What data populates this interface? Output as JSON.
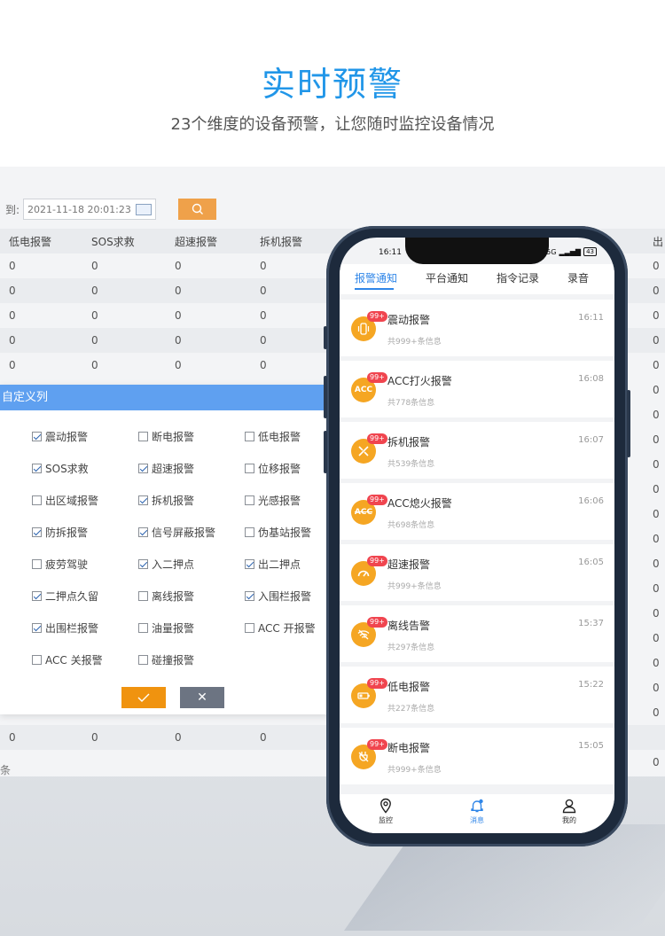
{
  "hero": {
    "title": "实时预警",
    "subtitle": "23个维度的设备预警，让您随时监控设备情况"
  },
  "desktop": {
    "filter_label": "到:",
    "date_value": "2021-11-18 20:01:23",
    "columns": [
      "低电报警",
      "SOS求救",
      "超速报警",
      "拆机报警",
      "出"
    ],
    "rows": [
      [
        "0",
        "0",
        "0",
        "0",
        "0"
      ],
      [
        "0",
        "0",
        "0",
        "0",
        "0"
      ],
      [
        "0",
        "0",
        "0",
        "0",
        "0"
      ],
      [
        "0",
        "0",
        "0",
        "0",
        "0"
      ],
      [
        "0",
        "0",
        "0",
        "0",
        "0"
      ]
    ],
    "side_zeros": [
      "0",
      "0",
      "0",
      "0",
      "0",
      "0",
      "0",
      "0",
      "0",
      "0",
      "0",
      "0",
      "0",
      "0",
      "0",
      "0",
      "0",
      "0",
      "0"
    ],
    "bottom_row": [
      "0",
      "0",
      "0",
      "0"
    ],
    "footer": "条"
  },
  "dialog": {
    "title": "自定义列",
    "options": [
      {
        "label": "震动报警",
        "checked": true
      },
      {
        "label": "断电报警",
        "checked": false
      },
      {
        "label": "低电报警",
        "checked": false
      },
      {
        "label": "SOS求救",
        "checked": true
      },
      {
        "label": "超速报警",
        "checked": true
      },
      {
        "label": "位移报警",
        "checked": false
      },
      {
        "label": "出区域报警",
        "checked": false
      },
      {
        "label": "拆机报警",
        "checked": true
      },
      {
        "label": "光感报警",
        "checked": false
      },
      {
        "label": "防拆报警",
        "checked": true
      },
      {
        "label": "信号屏蔽报警",
        "checked": true
      },
      {
        "label": "伪基站报警",
        "checked": false
      },
      {
        "label": "疲劳驾驶",
        "checked": false
      },
      {
        "label": "入二押点",
        "checked": true
      },
      {
        "label": "出二押点",
        "checked": true
      },
      {
        "label": "二押点久留",
        "checked": true
      },
      {
        "label": "离线报警",
        "checked": false
      },
      {
        "label": "入围栏报警",
        "checked": true
      },
      {
        "label": "出围栏报警",
        "checked": true
      },
      {
        "label": "油量报警",
        "checked": false
      },
      {
        "label": "ACC 开报警",
        "checked": false
      },
      {
        "label": "ACC 关报警",
        "checked": false
      },
      {
        "label": "碰撞报警",
        "checked": false
      }
    ],
    "ok_icon": "check-icon",
    "cancel_label": "✕"
  },
  "phone": {
    "status_time": "16:11",
    "signal": "5G",
    "battery": "43",
    "tabs": [
      "报警通知",
      "平台通知",
      "指令记录",
      "录音"
    ],
    "active_tab": 0,
    "items": [
      {
        "icon": "vibration-icon",
        "badge": "99+",
        "title": "震动报警",
        "time": "16:11",
        "sub": "共999+条信息"
      },
      {
        "icon": "acc-on-icon",
        "badge": "99+",
        "title": "ACC打火报警",
        "time": "16:08",
        "sub": "共778条信息"
      },
      {
        "icon": "tools-icon",
        "badge": "99+",
        "title": "拆机报警",
        "time": "16:07",
        "sub": "共539条信息"
      },
      {
        "icon": "acc-off-icon",
        "badge": "99+",
        "title": "ACC熄火报警",
        "time": "16:06",
        "sub": "共698条信息"
      },
      {
        "icon": "speedometer-icon",
        "badge": "99+",
        "title": "超速报警",
        "time": "16:05",
        "sub": "共999+条信息"
      },
      {
        "icon": "offline-wifi-icon",
        "badge": "99+",
        "title": "离线告警",
        "time": "15:37",
        "sub": "共297条信息"
      },
      {
        "icon": "low-battery-icon",
        "badge": "99+",
        "title": "低电报警",
        "time": "15:22",
        "sub": "共227条信息"
      },
      {
        "icon": "power-off-icon",
        "badge": "99+",
        "title": "断电报警",
        "time": "15:05",
        "sub": "共999+条信息"
      }
    ],
    "nav": [
      "监控",
      "消息",
      "我的"
    ],
    "active_nav": 1,
    "colors": {
      "accent": "#2f86e8",
      "icon_bg": "#f5a623",
      "badge": "#f0454f"
    }
  }
}
